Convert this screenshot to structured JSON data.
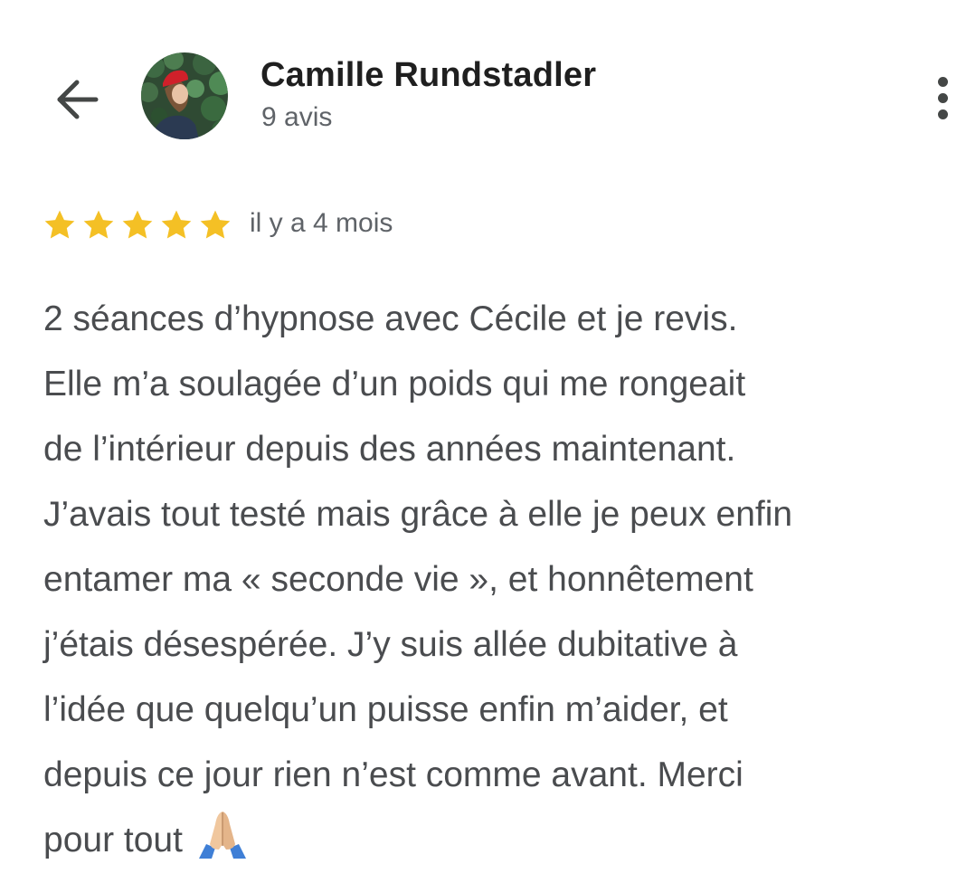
{
  "header": {
    "back_icon": "arrow-left-icon",
    "more_icon": "more-vert-icon",
    "reviewer": {
      "name": "Camille Rundstadler",
      "review_count": "9 avis",
      "avatar_icon": "user-avatar-photo"
    }
  },
  "review": {
    "rating": 5,
    "max_rating": 5,
    "star_color": "#f4c025",
    "date": "il y a 4 mois",
    "text_lines": [
      "2 séances d’hypnose avec Cécile et je revis.",
      "Elle m’a soulagée d’un poids qui me rongeait",
      "de l’intérieur depuis des années maintenant.",
      "J’avais tout testé mais grâce à elle je peux enfin",
      "entamer ma « seconde vie », et honnêtement",
      "j’étais désespérée. J’y suis allée dubitative à",
      "l’idée que quelqu’un puisse enfin m’aider, et",
      "depuis ce jour rien n’est comme avant. Merci",
      "pour tout"
    ],
    "trailing_emoji": "folded-hands-emoji"
  },
  "colors": {
    "name": "#1f1f1f",
    "secondary_text": "#5f6368",
    "body_text": "#4a4c4f",
    "icon": "#444746",
    "star": "#f4c025"
  }
}
